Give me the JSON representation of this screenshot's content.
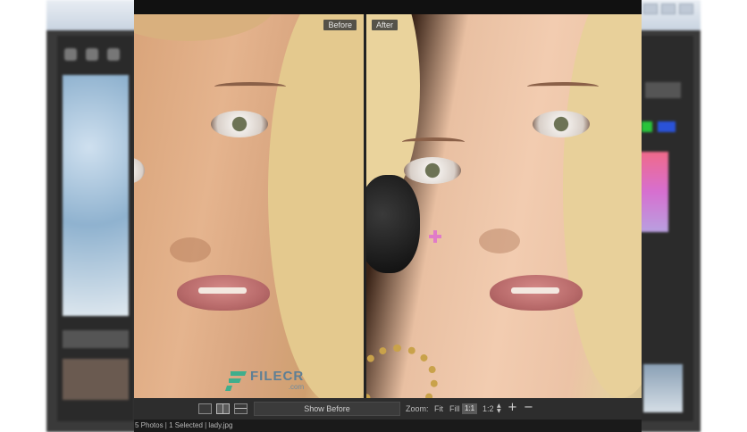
{
  "before_label": "Before",
  "after_label": "After",
  "watermark": {
    "name": "FILECR",
    "sub": ".com"
  },
  "toolbar": {
    "show_before_label": "Show Before",
    "zoom_label": "Zoom:",
    "zoom_fit": "Fit",
    "zoom_fill": "Fill",
    "zoom_1_1": "1:1",
    "zoom_ratio": "1:2",
    "zoom_in": "+",
    "zoom_out": "−"
  },
  "status_bar": "5 Photos | 1 Selected | lady.jpg",
  "colors": {
    "heal_marker": "#e07cc8",
    "toolbar_bg": "#2d2d2d"
  }
}
